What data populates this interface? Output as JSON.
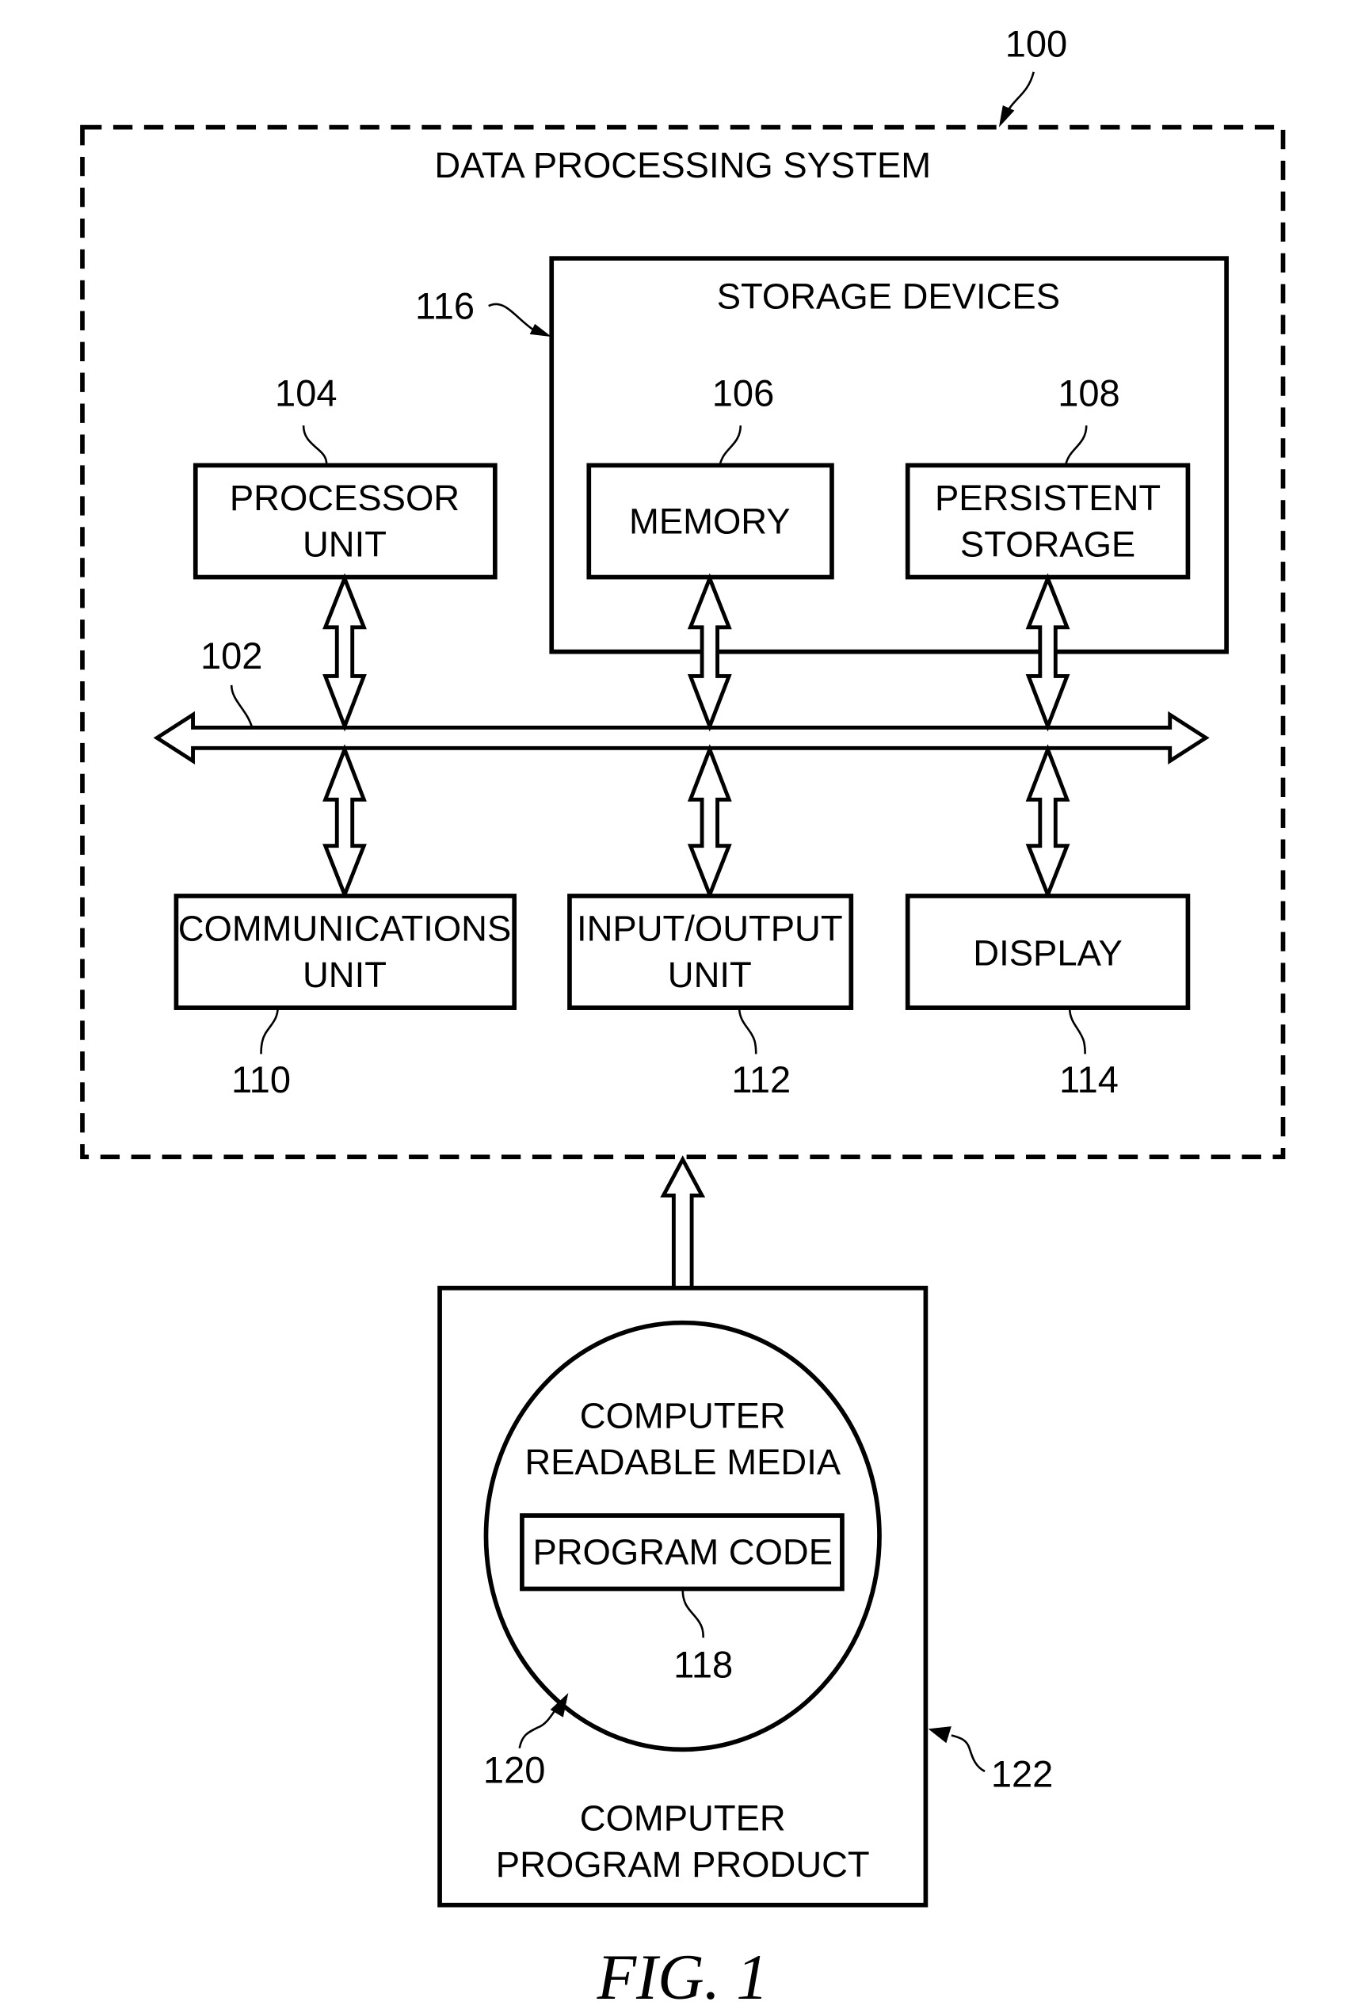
{
  "figure": {
    "caption": "FIG. 1",
    "system": {
      "ref": "100",
      "title": "DATA PROCESSING SYSTEM"
    },
    "storage_devices": {
      "ref": "116",
      "title": "STORAGE DEVICES"
    },
    "bus": {
      "ref": "102"
    },
    "components": {
      "processor": {
        "ref": "104",
        "line1": "PROCESSOR",
        "line2": "UNIT"
      },
      "memory": {
        "ref": "106",
        "line1": "MEMORY"
      },
      "persistent": {
        "ref": "108",
        "line1": "PERSISTENT",
        "line2": "STORAGE"
      },
      "communications": {
        "ref": "110",
        "line1": "COMMUNICATIONS",
        "line2": "UNIT"
      },
      "io": {
        "ref": "112",
        "line1": "INPUT/OUTPUT",
        "line2": "UNIT"
      },
      "display": {
        "ref": "114",
        "line1": "DISPLAY"
      }
    },
    "program_product": {
      "ref": "122",
      "line1": "COMPUTER",
      "line2": "PROGRAM PRODUCT",
      "media": {
        "ref": "120",
        "line1": "COMPUTER",
        "line2": "READABLE MEDIA"
      },
      "program_code": {
        "ref": "118",
        "label": "PROGRAM CODE"
      }
    }
  }
}
